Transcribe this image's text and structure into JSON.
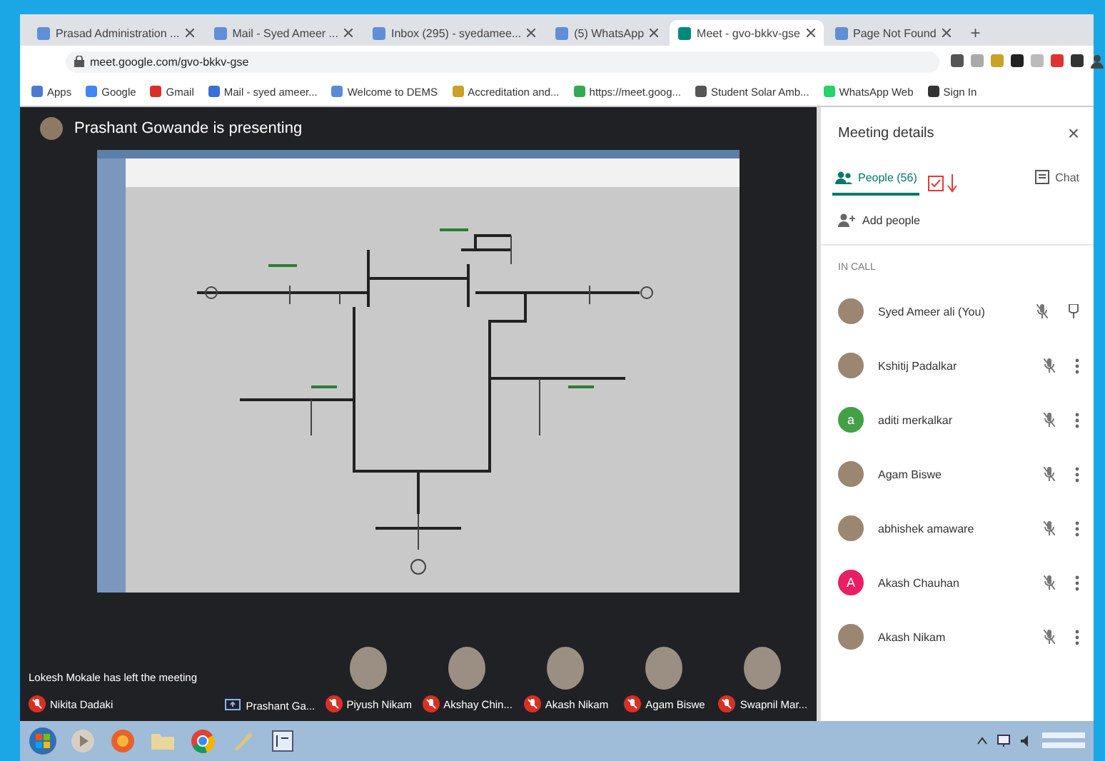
{
  "browser": {
    "tabs": [
      {
        "title": "Prasad Administration ...",
        "selected": false
      },
      {
        "title": "Mail - Syed Ameer ...",
        "selected": false
      },
      {
        "title": "Inbox (295) - syedamee...",
        "selected": false
      },
      {
        "title": "(5) WhatsApp",
        "selected": false
      },
      {
        "title": "Meet - gvo-bkkv-gse",
        "selected": true
      },
      {
        "title": "Page Not Found",
        "selected": false
      }
    ],
    "new_tab": "+",
    "url": "meet.google.com/gvo-bkkv-gse",
    "bookmarks": [
      "Apps",
      "Google",
      "Gmail",
      "Mail - syed ameer...",
      "Welcome to DEMS",
      "Accreditation and...",
      "https://meet.goog...",
      "Student Solar Amb...",
      "WhatsApp Web",
      "Sign In"
    ]
  },
  "stage": {
    "presenter": "Prashant Gowande is presenting",
    "notice": "Lokesh Mokale has left the meeting",
    "tiles": [
      {
        "name": "Nikita Dadaki",
        "kind": "muted",
        "avatar": false
      },
      {
        "name": "Prashant Ga...",
        "kind": "presenting",
        "avatar": false
      },
      {
        "name": "Piyush Nikam",
        "kind": "muted",
        "avatar": true
      },
      {
        "name": "Akshay Chin...",
        "kind": "muted",
        "avatar": true
      },
      {
        "name": "Akash Nikam",
        "kind": "muted",
        "avatar": true
      },
      {
        "name": "Agam Biswe",
        "kind": "muted",
        "avatar": true
      },
      {
        "name": "Swapnil Mar...",
        "kind": "muted",
        "avatar": true
      }
    ]
  },
  "panel": {
    "title": "Meeting details",
    "close": "×",
    "tabs": [
      {
        "label": "People (56)",
        "selected": true
      },
      {
        "label": "Chat",
        "selected": false
      }
    ],
    "add_people": "Add people",
    "section": "IN CALL",
    "people": [
      {
        "name": "Syed Ameer ali (You)",
        "kind": "photo",
        "pinnable": true
      },
      {
        "name": "Kshitij Padalkar",
        "kind": "photo",
        "pinnable": false
      },
      {
        "name": "aditi merkalkar",
        "kind": "letter",
        "initial": "a",
        "color": "#43a047",
        "pinnable": false
      },
      {
        "name": "Agam Biswe",
        "kind": "photo",
        "pinnable": false
      },
      {
        "name": "abhishek amaware",
        "kind": "photo",
        "pinnable": false
      },
      {
        "name": "Akash Chauhan",
        "kind": "letter",
        "initial": "A",
        "color": "#e91e63",
        "pinnable": false
      },
      {
        "name": "Akash Nikam",
        "kind": "photo",
        "pinnable": false
      }
    ]
  }
}
